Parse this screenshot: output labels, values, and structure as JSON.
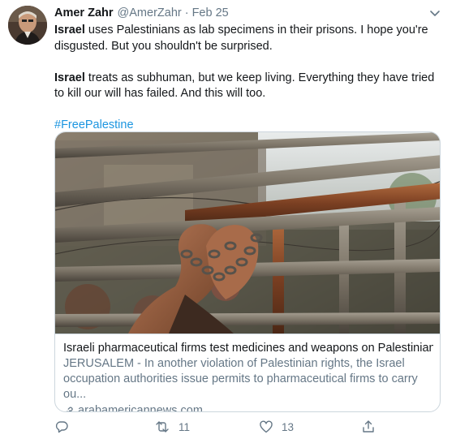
{
  "tweet": {
    "author_name": "Amer Zahr",
    "author_handle": "@AmerZahr",
    "separator": "·",
    "timestamp": "Feb 25",
    "paragraph1": {
      "bold": "Israel",
      "rest": " uses Palestinians as lab specimens in their prisons. I hope you're disgusted. But you shouldn't be surprised."
    },
    "paragraph2": {
      "bold": "Israel",
      "rest": " treats as subhuman, but we keep living. Everything they have tried to kill our will has failed. And this will too."
    },
    "hashtag": "#FreePalestine"
  },
  "card": {
    "title": "Israeli pharmaceutical firms test medicines and weapons on Palestinians",
    "description": "JERUSALEM - In another violation of Palestinian rights, the Israel occupation authorities issue permits to pharmaceutical firms to carry ou...",
    "domain": "arabamericannews.com"
  },
  "actions": {
    "reply_icon": "reply-icon",
    "retweet_icon": "retweet-icon",
    "retweet_count": "11",
    "like_icon": "heart-icon",
    "like_count": "13",
    "share_icon": "share-icon"
  },
  "colors": {
    "link": "#1b95e0",
    "secondary_text": "#657786",
    "border": "#ccd6dd"
  }
}
